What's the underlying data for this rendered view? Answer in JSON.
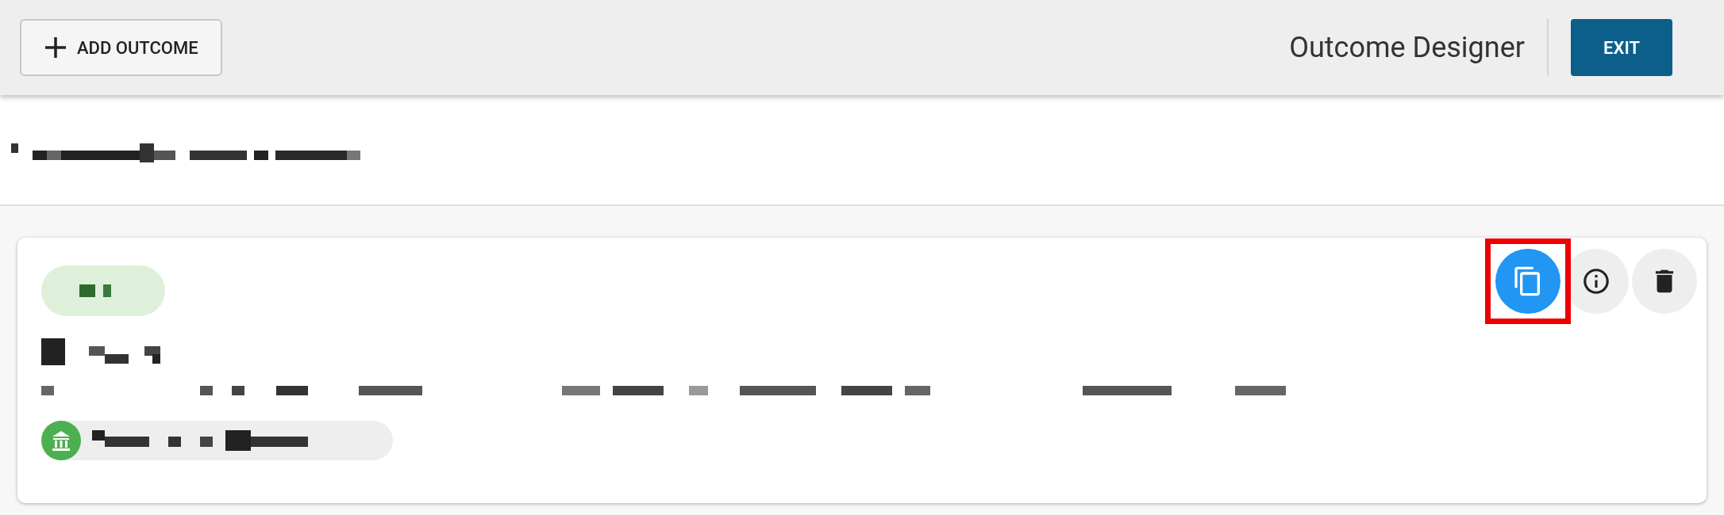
{
  "toolbar": {
    "add_button": {
      "label": "ADD OUTCOME"
    },
    "title": "Outcome Designer",
    "exit_button": {
      "label": "EXIT"
    }
  },
  "card": {
    "actions": [
      {
        "kind": "copy",
        "highlighted": true
      },
      {
        "kind": "info",
        "highlighted": false
      },
      {
        "kind": "delete",
        "highlighted": false
      }
    ]
  }
}
